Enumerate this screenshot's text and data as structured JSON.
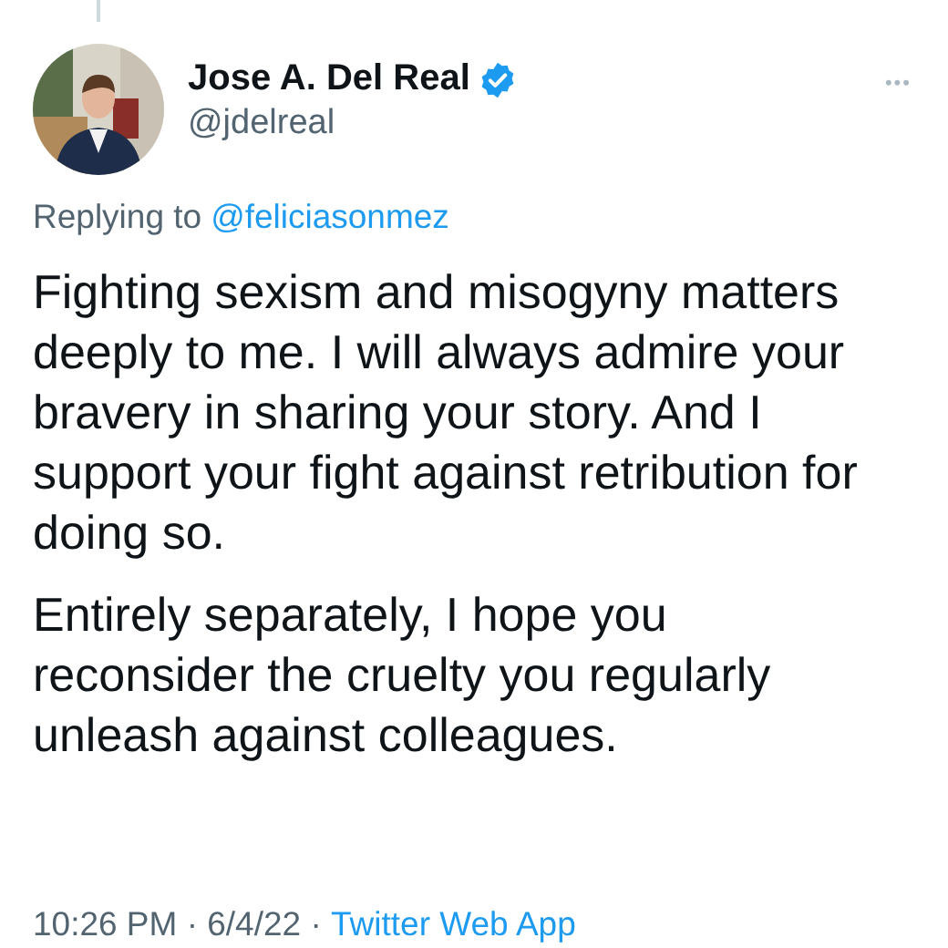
{
  "tweet": {
    "name": "Jose A. Del Real",
    "verified": true,
    "handle": "@jdelreal",
    "more": "•••",
    "replying_label": "Replying to",
    "replying_to": "@feliciasonmez",
    "paragraphs": [
      "Fighting sexism and misogyny matters deeply to me. I will always admire your bravery in sharing your story.  And I support your fight against retribution for doing so.",
      "Entirely separately, I hope you reconsider the cruelty you regularly unleash against colleagues."
    ],
    "timestamp": "10:26 PM · 6/4/22 · ",
    "source": "Twitter Web App"
  }
}
